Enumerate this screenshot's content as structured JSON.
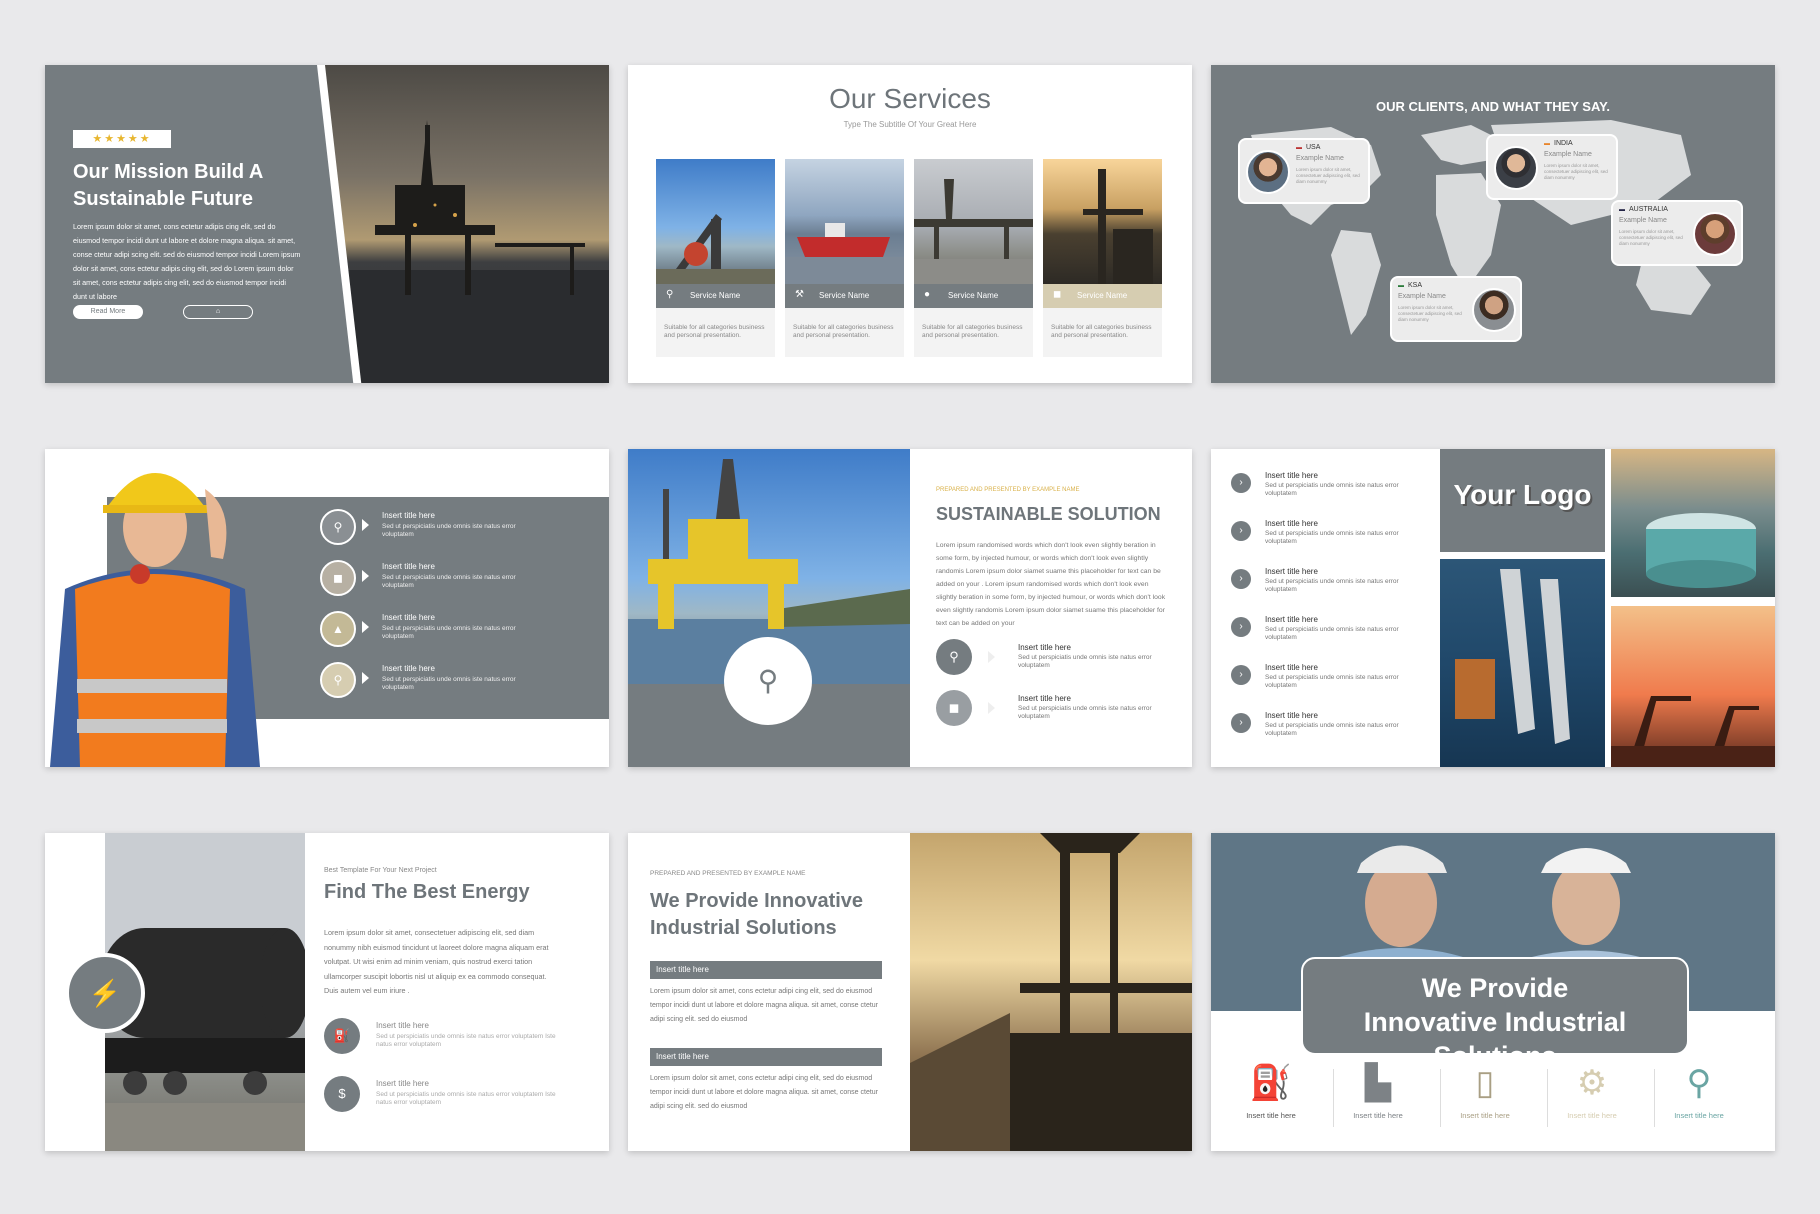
{
  "slide1": {
    "stars": "★★★★★",
    "title": "Our Mission Build A Sustainable Future",
    "body": "Lorem ipsum dolor sit amet, cons ectetur adipis cing elit, sed do eiusmod tempor incidi dunt ut labore et dolore magna aliqua. sit amet, conse ctetur adipi scing elit. sed do eiusmod tempor incidi Lorem ipsum dolor sit amet, cons ectetur adipis cing elit, sed do Lorem ipsum dolor sit amet, cons ectetur adipis cing elit, sed do eiusmod tempor incidi dunt ut labore",
    "button": "Read More"
  },
  "slide2": {
    "title": "Our Services",
    "subtitle": "Type The Subtitle Of Your Great Here",
    "cards": [
      {
        "label": "Service Name",
        "desc": "Suitable for all categories business and personal presentation."
      },
      {
        "label": "Service Name",
        "desc": "Suitable for all categories business and personal presentation."
      },
      {
        "label": "Service Name",
        "desc": "Suitable for all categories business and personal presentation."
      },
      {
        "label": "Service Name",
        "desc": "Suitable for all categories business and personal presentation."
      }
    ]
  },
  "slide3": {
    "title": "OUR CLIENTS, AND WHAT THEY SAY.",
    "clients": [
      {
        "country": "USA",
        "name": "Example Name",
        "text": "Lorem ipsum dolor sit amet, consectetuer adipiscing elit, sed diam nonummy"
      },
      {
        "country": "INDIA",
        "name": "Example Name",
        "text": "Lorem ipsum dolor sit amet, consectetuer adipiscing elit, sed diam nonummy"
      },
      {
        "country": "AUSTRALIA",
        "name": "Example Name",
        "text": "Lorem ipsum dolor sit amet, consectetuer adipiscing elit, sed diam nonummy"
      },
      {
        "country": "KSA",
        "name": "Example Name",
        "text": "Lorem ipsum dolor sit amet, consectetuer adipiscing elit, sed diam nonummy"
      }
    ]
  },
  "slide4": {
    "items": [
      {
        "title": "Insert title here",
        "desc": "Sed ut perspiciatis unde omnis iste natus error voluptatem"
      },
      {
        "title": "Insert title here",
        "desc": "Sed ut perspiciatis unde omnis iste natus error voluptatem"
      },
      {
        "title": "Insert title here",
        "desc": "Sed ut perspiciatis unde omnis iste natus error voluptatem"
      },
      {
        "title": "Insert title here",
        "desc": "Sed ut perspiciatis unde omnis iste natus error voluptatem"
      }
    ]
  },
  "slide5": {
    "kicker": "PREPARED AND PRESENTED BY EXAMPLE NAME",
    "title": "SUSTAINABLE SOLUTION",
    "body": "Lorem ipsum randomised words which don't look even slightly beration in some form, by injected humour, or words which don't look even slightly randomis Lorem ipsum dolor siamet suame this placeholder for text can be added on your . Lorem ipsum randomised words which don't look even slightly beration in some form, by injected humour, or words which don't look even slightly randomis Lorem ipsum dolor siamet suame this placeholder for text can be added on your",
    "items": [
      {
        "title": "Insert title here",
        "desc": "Sed ut perspiciatis unde omnis iste natus error voluptatem"
      },
      {
        "title": "Insert title here",
        "desc": "Sed ut perspiciatis unde omnis iste natus error voluptatem"
      }
    ]
  },
  "slide6": {
    "logo": "Your Logo",
    "items": [
      {
        "title": "Insert title here",
        "desc": "Sed ut perspiciatis unde omnis iste natus error voluptatem"
      },
      {
        "title": "Insert title here",
        "desc": "Sed ut perspiciatis unde omnis iste natus error voluptatem"
      },
      {
        "title": "Insert title here",
        "desc": "Sed ut perspiciatis unde omnis iste natus error voluptatem"
      },
      {
        "title": "Insert title here",
        "desc": "Sed ut perspiciatis unde omnis iste natus error voluptatem"
      },
      {
        "title": "Insert title here",
        "desc": "Sed ut perspiciatis unde omnis iste natus error voluptatem"
      },
      {
        "title": "Insert title here",
        "desc": "Sed ut perspiciatis unde omnis iste natus error voluptatem"
      }
    ]
  },
  "slide7": {
    "kicker": "Best Template For Your Next Project",
    "title": "Find The Best Energy",
    "body": "Lorem ipsum dolor sit amet, consectetuer adipiscing elit, sed diam nonummy nibh euismod tincidunt ut laoreet dolore magna aliquam erat volutpat. Ut wisi enim ad minim veniam, quis nostrud exerci tation ullamcorper suscipit lobortis nisl ut aliquip ex ea commodo consequat. Duis autem vel eum iriure .",
    "items": [
      {
        "title": "Insert title here",
        "desc": "Sed ut perspiciatis unde omnis iste natus error voluptatem Iste natus error voluptatem"
      },
      {
        "title": "Insert title here",
        "desc": "Sed ut perspiciatis unde omnis iste natus error voluptatem Iste natus error voluptatem"
      }
    ]
  },
  "slide8": {
    "kicker": "PREPARED AND PRESENTED BY EXAMPLE NAME",
    "title": "We Provide Innovative Industrial Solutions",
    "sections": [
      {
        "title": "Insert title here",
        "body": "Lorem ipsum dolor sit amet, cons ectetur adipi cing elit, sed do eiusmod tempor incidi dunt ut labore et dolore magna aliqua. sit amet, conse ctetur adipi scing elit. sed do eiusmod"
      },
      {
        "title": "Insert title here",
        "body": "Lorem ipsum dolor sit amet, cons ectetur adipi cing elit, sed do eiusmod tempor incidi dunt ut labore et dolore magna aliqua. sit amet, conse ctetur adipi scing elit. sed do eiusmod"
      }
    ]
  },
  "slide9": {
    "title": "We Provide Innovative Industrial Solutions",
    "icons": [
      {
        "label": "Insert title here"
      },
      {
        "label": "Insert title here"
      },
      {
        "label": "Insert title here"
      },
      {
        "label": "Insert title here"
      },
      {
        "label": "Insert title here"
      }
    ]
  },
  "colors": {
    "slate": "#757c80",
    "accent_gold": "#d9b14a",
    "teal": "#6aa5a3",
    "beige": "#d6cdb1"
  }
}
